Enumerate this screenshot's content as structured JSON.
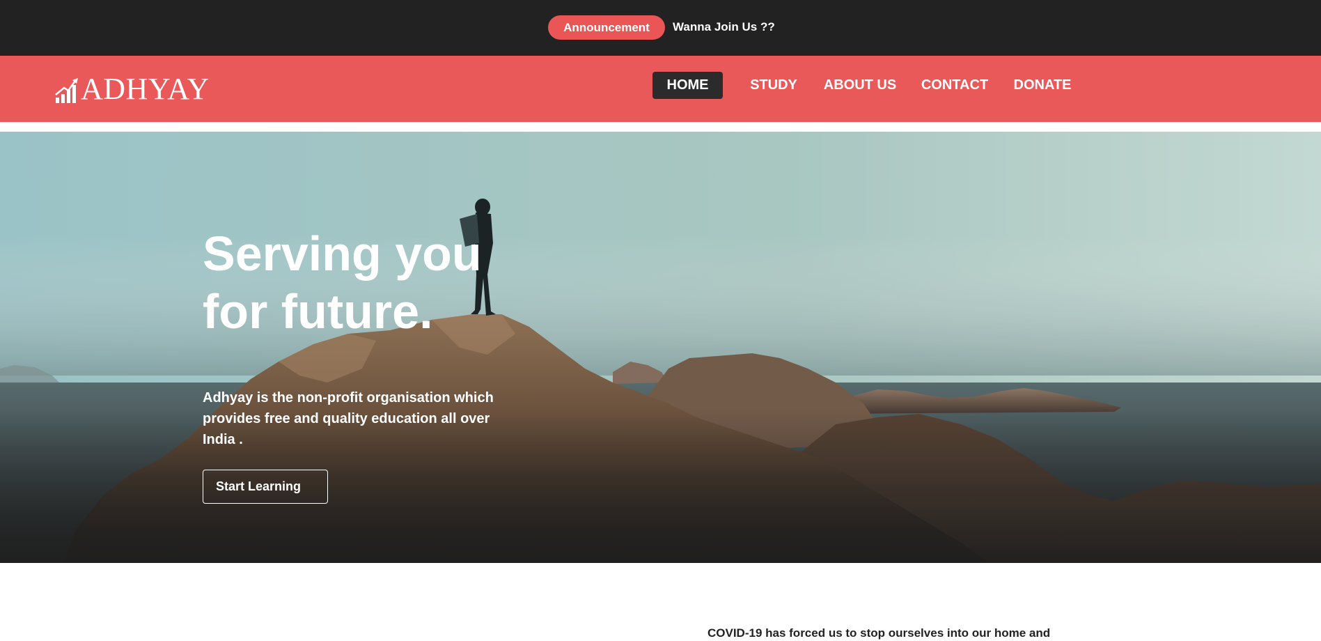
{
  "announcement": {
    "badge_label": "Announcement",
    "text": "Wanna Join Us ??",
    "badge_color": "#ea5555",
    "bar_color": "#222222"
  },
  "navbar": {
    "brand_name": "ADHYAY",
    "brand_icon": "growth-chart-arrow-icon",
    "bg_color": "#ea5959",
    "items": [
      {
        "label": "HOME",
        "active": true
      },
      {
        "label": "STUDY",
        "active": false
      },
      {
        "label": "ABOUT US",
        "active": false
      },
      {
        "label": "CONTACT",
        "active": false
      },
      {
        "label": "DONATE",
        "active": false
      }
    ]
  },
  "hero": {
    "title_line1": "Serving you",
    "title_line2": "for future.",
    "description": "Adhyay is the non-profit organisation which provides free and quality education all over India .",
    "cta_label": "Start Learning",
    "image": "hiker-on-coastal-rocks"
  },
  "about": {
    "text": "COVID-19 has forced us to stop ourselves into our home and"
  }
}
